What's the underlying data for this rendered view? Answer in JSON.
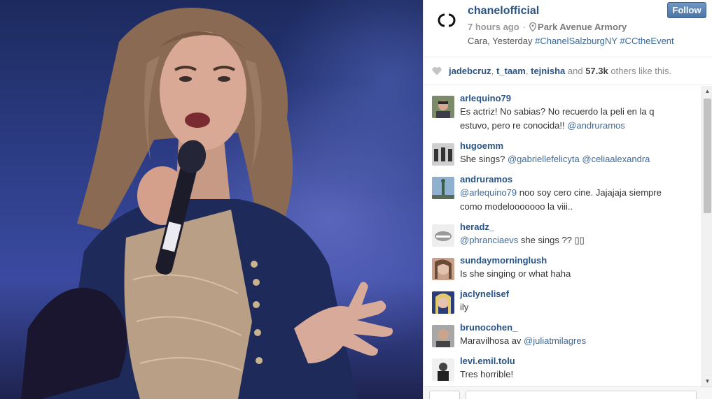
{
  "post": {
    "username": "chanelofficial",
    "time": "7 hours ago",
    "separator": "·",
    "location": "Park Avenue Armory",
    "caption_text": "Cara, Yesterday",
    "caption_tags": [
      "#ChanelSalzburgNY",
      "#CCtheEvent"
    ],
    "follow_label": "Follow"
  },
  "likes": {
    "users": [
      "jadebcruz",
      "t_taam",
      "tejnisha"
    ],
    "sep1": ",",
    "and_text": "and",
    "count": "57.3k",
    "suffix": "others like this."
  },
  "comments": [
    {
      "user": "arlequino79",
      "parts": [
        {
          "t": "Es actriz! No sabias? No recuerdo la peli en la q estuvo, pero re conocida!! "
        },
        {
          "t": "@andruramos",
          "m": true
        }
      ]
    },
    {
      "user": "hugoemm",
      "parts": [
        {
          "t": "She sings? "
        },
        {
          "t": "@gabriellefelicyta",
          "m": true
        },
        {
          "t": " "
        },
        {
          "t": "@celiaalexandra",
          "m": true
        }
      ]
    },
    {
      "user": "andruramos",
      "parts": [
        {
          "t": "@arlequino79",
          "m": true
        },
        {
          "t": " noo soy cero cine. Jajajaja siempre como modelooooooo la viii.."
        }
      ]
    },
    {
      "user": "heradz_",
      "parts": [
        {
          "t": "@phranciaevs",
          "m": true
        },
        {
          "t": " she sings ?? ▯▯"
        }
      ]
    },
    {
      "user": "sundaymorninglush",
      "parts": [
        {
          "t": "Is she singing or what haha"
        }
      ]
    },
    {
      "user": "jaclynelisef",
      "parts": [
        {
          "t": "ily"
        }
      ]
    },
    {
      "user": "brunocohen_",
      "parts": [
        {
          "t": "Maravilhosa av "
        },
        {
          "t": "@juliatmilagres",
          "m": true
        }
      ]
    },
    {
      "user": "levi.emil.tolu",
      "parts": [
        {
          "t": "Tres horrible!"
        }
      ]
    }
  ],
  "icons": {
    "logo": "chanel-logo-icon",
    "location": "location-pin-icon",
    "like": "heart-icon",
    "scroll_up": "scroll-up-arrow-icon",
    "scroll_down": "scroll-down-arrow-icon"
  },
  "colors": {
    "username": "#2b5486",
    "hashtag": "#3e6a9a",
    "follow_button": "#4b76a8"
  }
}
